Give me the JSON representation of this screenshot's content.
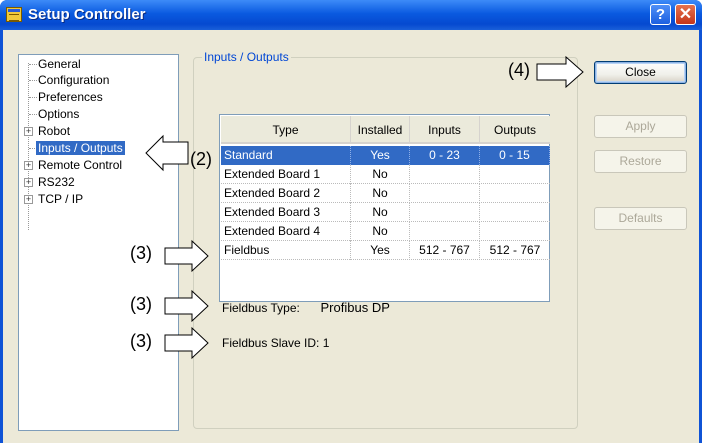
{
  "window": {
    "title": "Setup Controller",
    "help_symbol": "?",
    "close_symbol": "✕"
  },
  "tree": {
    "items": [
      {
        "label": "General",
        "expandable": false
      },
      {
        "label": "Configuration",
        "expandable": false
      },
      {
        "label": "Preferences",
        "expandable": false
      },
      {
        "label": "Options",
        "expandable": false
      },
      {
        "label": "Robot",
        "expandable": true
      },
      {
        "label": "Inputs / Outputs",
        "expandable": false,
        "selected": true
      },
      {
        "label": "Remote Control",
        "expandable": true
      },
      {
        "label": "RS232",
        "expandable": true
      },
      {
        "label": "TCP / IP",
        "expandable": true
      }
    ],
    "expand_symbol": "+"
  },
  "group": {
    "label": "Inputs / Outputs"
  },
  "table": {
    "headers": [
      "Type",
      "Installed",
      "Inputs",
      "Outputs"
    ],
    "rows": [
      [
        "Standard",
        "Yes",
        "0 - 23",
        "0 - 15"
      ],
      [
        "Extended Board 1",
        "No",
        "",
        ""
      ],
      [
        "Extended Board 2",
        "No",
        "",
        ""
      ],
      [
        "Extended Board 3",
        "No",
        "",
        ""
      ],
      [
        "Extended Board 4",
        "No",
        "",
        ""
      ],
      [
        "Fieldbus",
        "Yes",
        "512 - 767",
        "512 - 767"
      ]
    ],
    "selected_row": 0
  },
  "fieldbus": {
    "type_label": "Fieldbus Type:",
    "type_value": "Profibus DP",
    "slave_label": "Fieldbus Slave ID:",
    "slave_value": "1"
  },
  "buttons": {
    "close": "Close",
    "apply": "Apply",
    "restore": "Restore",
    "defaults": "Defaults"
  },
  "callouts": {
    "c2": "(2)",
    "c3a": "(3)",
    "c3b": "(3)",
    "c3c": "(3)",
    "c4": "(4)"
  },
  "colors": {
    "titlebar": "#0a5ae0",
    "selection": "#316ac5",
    "dialog_bg": "#ece9d8",
    "group_label": "#0046d5"
  }
}
